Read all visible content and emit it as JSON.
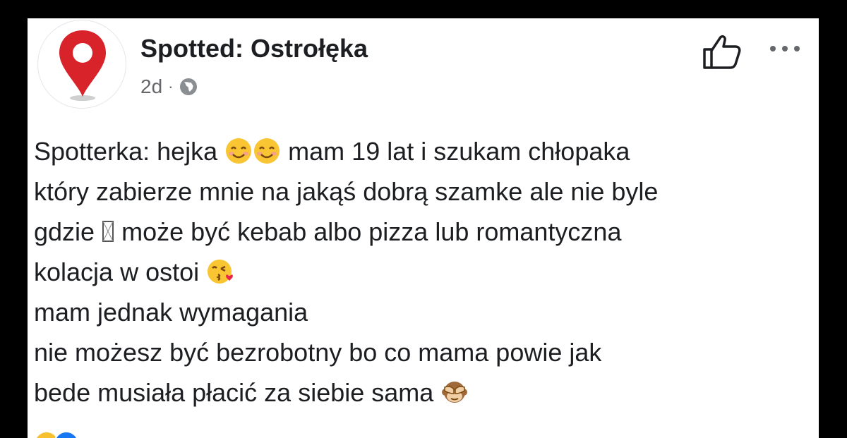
{
  "post": {
    "page_name": "Spotted: Ostrołęka",
    "timestamp": "2d",
    "separator": "·",
    "privacy_icon": "globe-icon",
    "avatar_icon": "map-pin-icon",
    "actions": [
      "like-page-icon",
      "more-options-icon"
    ],
    "text_parts": {
      "l1a": "Spotterka: hejka ",
      "l1b": " mam 19 lat i szukam chłopaka",
      "l2": "który zabierze mnie na jakąś dobrą szamke ale nie byle",
      "l3a": "gdzie ",
      "l3b": " może być kebab albo pizza lub romantyczna",
      "l4": "kolacja w ostoi ",
      "l5": "mam jednak wymagania",
      "l6": "nie możesz być bezrobotny bo co mama powie jak",
      "l7": "bede musiała płacić za siebie sama "
    },
    "emojis": [
      "smiling-face-emoji",
      "smiling-face-emoji",
      "missing-glyph-box",
      "kissing-face-emoji",
      "see-no-evil-monkey-emoji"
    ],
    "reactions": [
      "haha-reaction-icon",
      "like-reaction-icon"
    ]
  },
  "colors": {
    "background": "#000000",
    "card": "#ffffff",
    "text": "#1c1e21",
    "secondary_text": "#65676b",
    "pin_red": "#d8232a"
  }
}
